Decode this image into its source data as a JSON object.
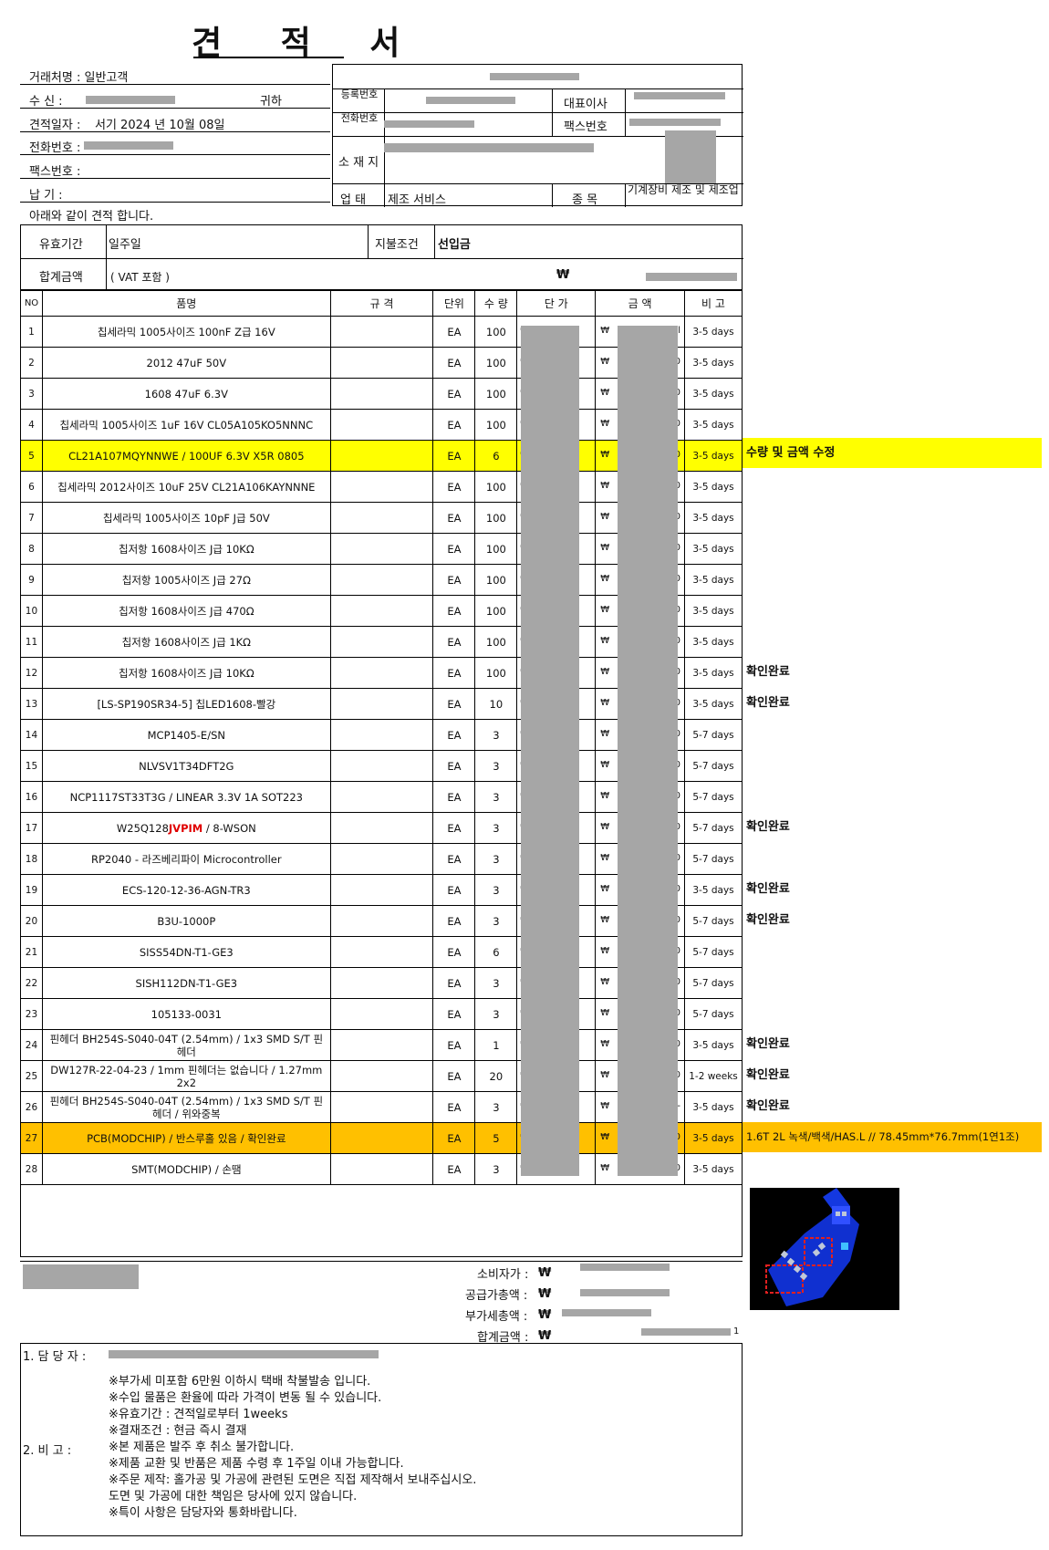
{
  "doc": {
    "title": "견 적 서"
  },
  "client": {
    "dealer_label": "거래처명 :",
    "dealer_value": "일반고객",
    "to_label": "수   신 :",
    "to_suffix": "귀하",
    "date_label": "견적일자 :",
    "date_value": "서기 2024 년 10월 08일",
    "phone_label": "전화번호 :",
    "fax_label": "팩스번호 :",
    "delivery_label": "납   기 :",
    "intro": "아래와 같이 견적 합니다."
  },
  "supplier": {
    "reg_label": "등록번호",
    "rep_label": "대표이사",
    "tel_label": "전화번호",
    "fax_label": "팩스번호",
    "addr_label": "소 재 지",
    "biz_label": "업   태",
    "biz_value": "제조 서비스",
    "item_label": "종   목",
    "item_value": "기계장비 제조 및 제조업"
  },
  "terms": {
    "validity_label": "유효기간",
    "validity_value": "일주일",
    "payment_label": "지불조건",
    "payment_value": "선입금",
    "total_label": "합계금액",
    "vat_note": "( VAT 포함 )",
    "won": "₩"
  },
  "table": {
    "headers": [
      "NO",
      "품명",
      "규 격",
      "단위",
      "수 량",
      "단 가",
      "금 액",
      "비 고"
    ],
    "rows": [
      {
        "no": "1",
        "name": "칩세라믹 1005사이즈 100nF Z급 16V",
        "unit": "EA",
        "qty": "100",
        "price_sym": "₩",
        "amt_sym": "₩",
        "amt_tail": "ll",
        "lead": "3-5 days",
        "remark": ""
      },
      {
        "no": "2",
        "name": "2012 47uF 50V",
        "unit": "EA",
        "qty": "100",
        "price_sym": "₩",
        "amt_sym": "₩",
        "amt_tail": "0",
        "lead": "3-5 days",
        "remark": ""
      },
      {
        "no": "3",
        "name": "1608 47uF 6.3V",
        "unit": "EA",
        "qty": "100",
        "price_sym": "₩",
        "amt_sym": "₩",
        "amt_tail": "0",
        "lead": "3-5 days",
        "remark": ""
      },
      {
        "no": "4",
        "name": "칩세라믹 1005사이즈 1uF 16V CL05A105KO5NNNC",
        "unit": "EA",
        "qty": "100",
        "price_sym": "₩",
        "amt_sym": "₩",
        "amt_tail": "0",
        "lead": "3-5 days",
        "remark": ""
      },
      {
        "no": "5",
        "name": "CL21A107MQYNNWE / 100UF 6.3V X5R 0805",
        "unit": "EA",
        "qty": "6",
        "price_sym": "₩",
        "amt_sym": "₩",
        "amt_tail": "0",
        "lead": "3-5 days",
        "remark": "수량 및 금액 수정",
        "hl": "#ffff00"
      },
      {
        "no": "6",
        "name": "칩세라믹 2012사이즈 10uF 25V CL21A106KAYNNNE",
        "unit": "EA",
        "qty": "100",
        "price_sym": "₩",
        "amt_sym": "₩",
        "amt_tail": "0",
        "lead": "3-5 days",
        "remark": ""
      },
      {
        "no": "7",
        "name": "칩세라믹 1005사이즈 10pF J급 50V",
        "unit": "EA",
        "qty": "100",
        "price_sym": "₩",
        "amt_sym": "₩",
        "amt_tail": "0",
        "lead": "3-5 days",
        "remark": ""
      },
      {
        "no": "8",
        "name": "칩저항 1608사이즈 J급 10KΩ",
        "unit": "EA",
        "qty": "100",
        "price_sym": "₩",
        "amt_sym": "₩",
        "amt_tail": "0",
        "lead": "3-5 days",
        "remark": ""
      },
      {
        "no": "9",
        "name": "칩저항 1005사이즈 J급 27Ω",
        "unit": "EA",
        "qty": "100",
        "price_sym": "₩",
        "amt_sym": "₩",
        "amt_tail": "0",
        "lead": "3-5 days",
        "remark": ""
      },
      {
        "no": "10",
        "name": "칩저항 1608사이즈 J급 470Ω",
        "unit": "EA",
        "qty": "100",
        "price_sym": "₩",
        "amt_sym": "₩",
        "amt_tail": "0",
        "lead": "3-5 days",
        "remark": ""
      },
      {
        "no": "11",
        "name": "칩저항 1608사이즈 J급 1KΩ",
        "unit": "EA",
        "qty": "100",
        "price_sym": "₩",
        "amt_sym": "₩",
        "amt_tail": "0",
        "lead": "3-5 days",
        "remark": ""
      },
      {
        "no": "12",
        "name": "칩저항 1608사이즈 J급 10KΩ",
        "unit": "EA",
        "qty": "100",
        "price_sym": "₩",
        "amt_sym": "₩",
        "amt_tail": "0",
        "lead": "3-5 days",
        "remark": "확인완료"
      },
      {
        "no": "13",
        "name": "[LS-SP190SR34-5] 칩LED1608-빨강",
        "unit": "EA",
        "qty": "10",
        "price_sym": "₩",
        "amt_sym": "₩",
        "amt_tail": "0",
        "lead": "3-5 days",
        "remark": "확인완료"
      },
      {
        "no": "14",
        "name": "MCP1405-E/SN",
        "unit": "EA",
        "qty": "3",
        "price_sym": "₩",
        "amt_sym": "₩",
        "amt_tail": "0",
        "lead": "5-7 days",
        "remark": ""
      },
      {
        "no": "15",
        "name": "NLVSV1T34DFT2G",
        "unit": "EA",
        "qty": "3",
        "price_sym": "₩",
        "amt_sym": "₩",
        "amt_tail": "0",
        "lead": "5-7 days",
        "remark": ""
      },
      {
        "no": "16",
        "name": "NCP1117ST33T3G / LINEAR 3.3V 1A SOT223",
        "unit": "EA",
        "qty": "3",
        "price_sym": "₩",
        "amt_sym": "₩",
        "amt_tail": "0",
        "lead": "5-7 days",
        "remark": ""
      },
      {
        "no": "17",
        "name": "W25Q128",
        "name_red": "JVPIM",
        "name_after": " / 8-WSON",
        "unit": "EA",
        "qty": "3",
        "price_sym": "₩",
        "amt_sym": "₩",
        "amt_tail": "0",
        "lead": "5-7 days",
        "remark": "확인완료"
      },
      {
        "no": "18",
        "name": "RP2040 - 라즈베리파이 Microcontroller",
        "unit": "EA",
        "qty": "3",
        "price_sym": "₩",
        "amt_sym": "₩",
        "amt_tail": "0",
        "lead": "5-7 days",
        "remark": ""
      },
      {
        "no": "19",
        "name": "ECS-120-12-36-AGN-TR3",
        "unit": "EA",
        "qty": "3",
        "price_sym": "₩",
        "amt_sym": "₩",
        "amt_tail": "0",
        "lead": "3-5 days",
        "remark": "확인완료"
      },
      {
        "no": "20",
        "name": "B3U-1000P",
        "unit": "EA",
        "qty": "3",
        "price_sym": "₩",
        "amt_sym": "₩",
        "amt_tail": "0",
        "lead": "5-7 days",
        "remark": "확인완료"
      },
      {
        "no": "21",
        "name": "SISS54DN-T1-GE3",
        "unit": "EA",
        "qty": "6",
        "price_sym": "₩",
        "amt_sym": "₩",
        "amt_tail": "0",
        "lead": "5-7 days",
        "remark": ""
      },
      {
        "no": "22",
        "name": "SISH112DN-T1-GE3",
        "unit": "EA",
        "qty": "3",
        "price_sym": "₩",
        "amt_sym": "₩",
        "amt_tail": "0",
        "lead": "5-7 days",
        "remark": ""
      },
      {
        "no": "23",
        "name": "105133-0031",
        "unit": "EA",
        "qty": "3",
        "price_sym": "₩",
        "amt_sym": "₩",
        "amt_tail": "0",
        "lead": "5-7 days",
        "remark": ""
      },
      {
        "no": "24",
        "name": "핀헤더 BH254S-S040-04T (2.54mm) / 1x3 SMD S/T 핀헤더",
        "unit": "EA",
        "qty": "1",
        "price_sym": "₩",
        "amt_sym": "₩",
        "amt_tail": "0",
        "lead": "3-5 days",
        "remark": "확인완료"
      },
      {
        "no": "25",
        "name": "DW127R-22-04-23 / 1mm 핀헤더는 없습니다 / 1.27mm 2x2",
        "unit": "EA",
        "qty": "20",
        "price_sym": "₩",
        "amt_sym": "₩",
        "amt_tail": "0",
        "lead": "1-2 weeks",
        "remark": "확인완료"
      },
      {
        "no": "26",
        "name": "핀헤더 BH254S-S040-04T (2.54mm) / 1x3 SMD S/T 핀헤더 / 위와중복",
        "unit": "EA",
        "qty": "3",
        "price_sym": "₩",
        "amt_sym": "₩",
        "amt_tail": "-",
        "lead": "3-5 days",
        "remark": "확인완료"
      },
      {
        "no": "27",
        "name": "PCB(MODCHIP) / 반스루홀 있음 / 확인완료",
        "unit": "EA",
        "qty": "5",
        "price_sym": "₩",
        "amt_sym": "₩",
        "amt_tail": "0",
        "lead": "3-5 days",
        "remark": "1.6T 2L 녹색/백색/HAS.L // 78.45mm*76.7mm(1연1조)",
        "hl": "#ffc000"
      },
      {
        "no": "28",
        "name": "SMT(MODCHIP) / 손땜",
        "unit": "EA",
        "qty": "3",
        "price_sym": "₩",
        "amt_sym": "₩",
        "amt_tail": "0",
        "lead": "3-5 days",
        "remark": ""
      }
    ]
  },
  "totals": {
    "consumer_label": "소비자가 :",
    "supply_label": "공급가총액 :",
    "vat_label": "부가세총액 :",
    "sum_label": "합계금액 :",
    "won": "₩",
    "sum_tail": "1"
  },
  "footer": {
    "manager_label": "1. 담 당 자 :",
    "remarks_label": "2. 비   고 :",
    "notes": [
      "※부가세 미포함 6만원 이하시 택배 착불발송 입니다.",
      "※수입 물품은 환율에 따라 가격이 변동 될 수 있습니다.",
      "※유효기간 : 견적일로부터 1weeks",
      "※결재조건 : 현금 즉시 결재",
      "※본 제품은 발주 후 취소 불가합니다.",
      "※제품 교환 및 반품은 제품 수령 후 1주일 이내 가능합니다.",
      "※주문 제작: 홀가공 및 가공에 관련된 도면은 직접 제작해서 보내주십시오.",
      "도면 및 가공에 대한 책임은 당사에 있지 않습니다.",
      "※특이 사항은 담당자와 통화바랍니다."
    ]
  },
  "colors": {
    "highlight_yellow": "#ffff00",
    "highlight_orange": "#ffc000",
    "redaction": "#a6a6a6",
    "red_text": "#e00000"
  }
}
